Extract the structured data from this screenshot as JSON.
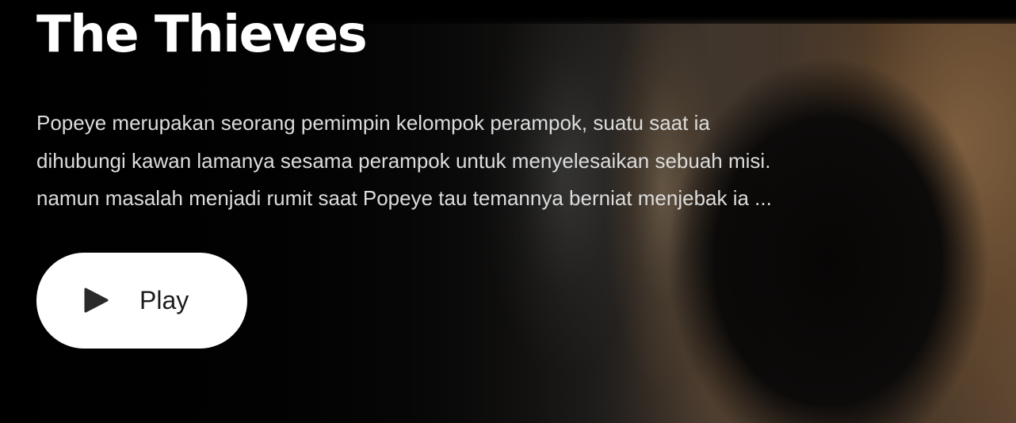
{
  "hero": {
    "title": "The Thieves",
    "synopsis_lines": [
      "Popeye merupakan seorang pemimpin kelompok perampok, suatu saat ia",
      "dihubungi kawan lamanya sesama perampok untuk menyelesaikan sebuah misi.",
      "namun masalah menjadi rumit saat Popeye tau temannya berniat menjebak ia ..."
    ],
    "play_button": {
      "label": "Play",
      "icon": "play-icon"
    }
  },
  "colors": {
    "title_text": "#ffffff",
    "synopsis_text": "#dcdcdc",
    "button_background": "#ffffff",
    "button_text": "#1c1c1c",
    "icon": "#2a2a2a"
  }
}
